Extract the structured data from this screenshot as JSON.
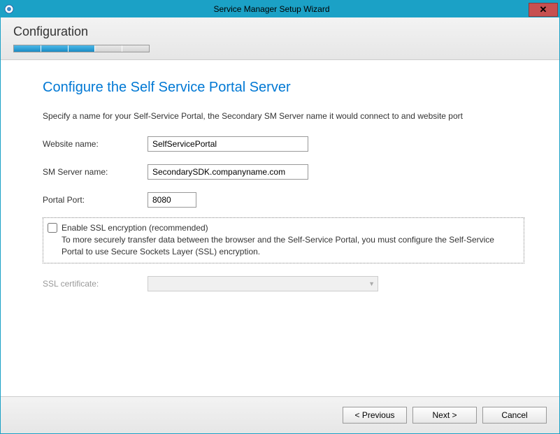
{
  "window": {
    "title": "Service Manager Setup Wizard"
  },
  "header": {
    "section_title": "Configuration",
    "progress_total": 5,
    "progress_filled": 3
  },
  "page": {
    "title": "Configure the Self Service Portal Server",
    "description": "Specify a name for your Self-Service Portal, the Secondary SM Server name it would connect to and website port",
    "fields": {
      "website_name_label": "Website name:",
      "website_name_value": "SelfServicePortal",
      "sm_server_label": "SM Server name:",
      "sm_server_value": "SecondarySDK.companyname.com",
      "portal_port_label": "Portal Port:",
      "portal_port_value": "8080"
    },
    "ssl": {
      "checkbox_label": "Enable SSL encryption (recommended)",
      "description": "To more securely transfer data between the browser and the Self-Service Portal, you must configure the Self-Service Portal to use Secure Sockets Layer (SSL) encryption.",
      "cert_label": "SSL certificate:",
      "checked": false
    }
  },
  "buttons": {
    "previous": "< Previous",
    "next": "Next >",
    "cancel": "Cancel"
  }
}
